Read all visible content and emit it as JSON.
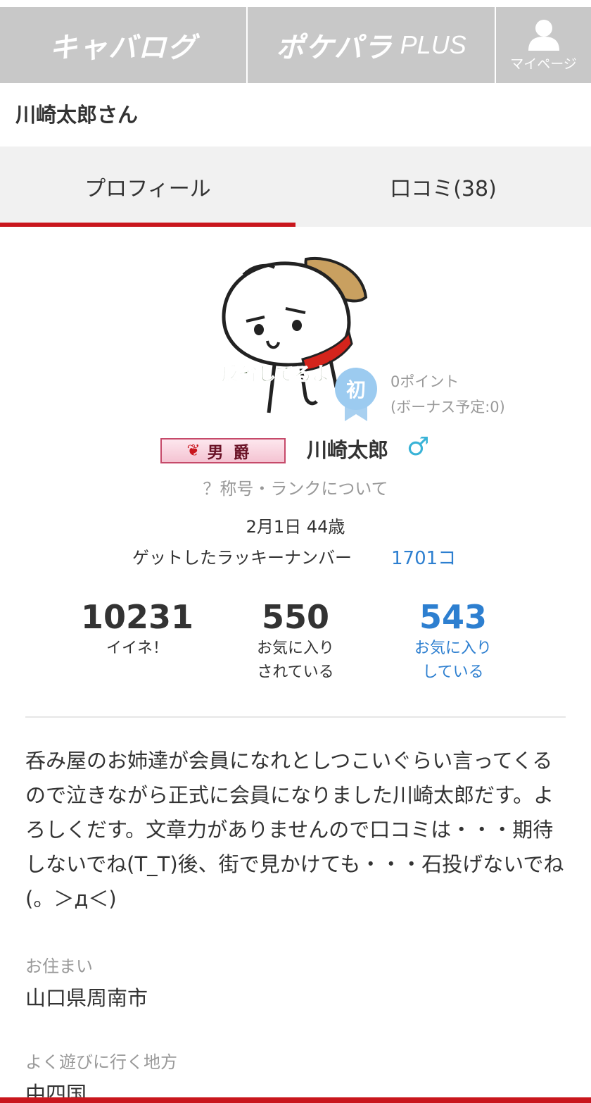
{
  "nav": {
    "logo1": "キャバログ",
    "logo2_main": "ポケパラ",
    "logo2_plus": "PLUS",
    "mypage_label": "マイページ",
    "mypage_icon": "person-icon"
  },
  "header": {
    "title": "川崎太郎さん"
  },
  "tabs": [
    {
      "label": "プロフィール",
      "active": true
    },
    {
      "label": "口コミ(38)",
      "active": false
    }
  ],
  "profile": {
    "avatar_caption": "反省してるよ",
    "first_badge": "初",
    "points": "0ポイント",
    "bonus": "(ボーナス予定:0)",
    "rank_title": "男爵",
    "name": "川崎太郎",
    "gender_symbol": "♂",
    "rank_link": "？称号・ランクについて",
    "birthday": "2月1日 44歳",
    "lucky_label": "ゲットしたラッキーナンバー",
    "lucky_value": "1701コ"
  },
  "stats": [
    {
      "value": "10231",
      "label1": "イイネ！",
      "label2": ""
    },
    {
      "value": "550",
      "label1": "お気に入り",
      "label2": "されている"
    },
    {
      "value": "543",
      "label1": "お気に入り",
      "label2": "している"
    }
  ],
  "bio": "呑み屋のお姉達が会員になれとしつこいぐらい言ってくるので泣きながら正式に会員になりました川崎太郎だす。よろしくだす。文章力がありませんので口コミは・・・期待しないでね(T_T)後、街で見かけても・・・石投げないでね(。＞д＜)",
  "fields": [
    {
      "label": "お住まい",
      "value": "山口県周南市"
    },
    {
      "label": "よく遊びに行く地方",
      "value": "中四国"
    }
  ],
  "colors": {
    "accent": "#c9161d",
    "link": "#2d7fd0",
    "gender": "#39b3d7",
    "nav_bg": "#c8c8c8"
  }
}
